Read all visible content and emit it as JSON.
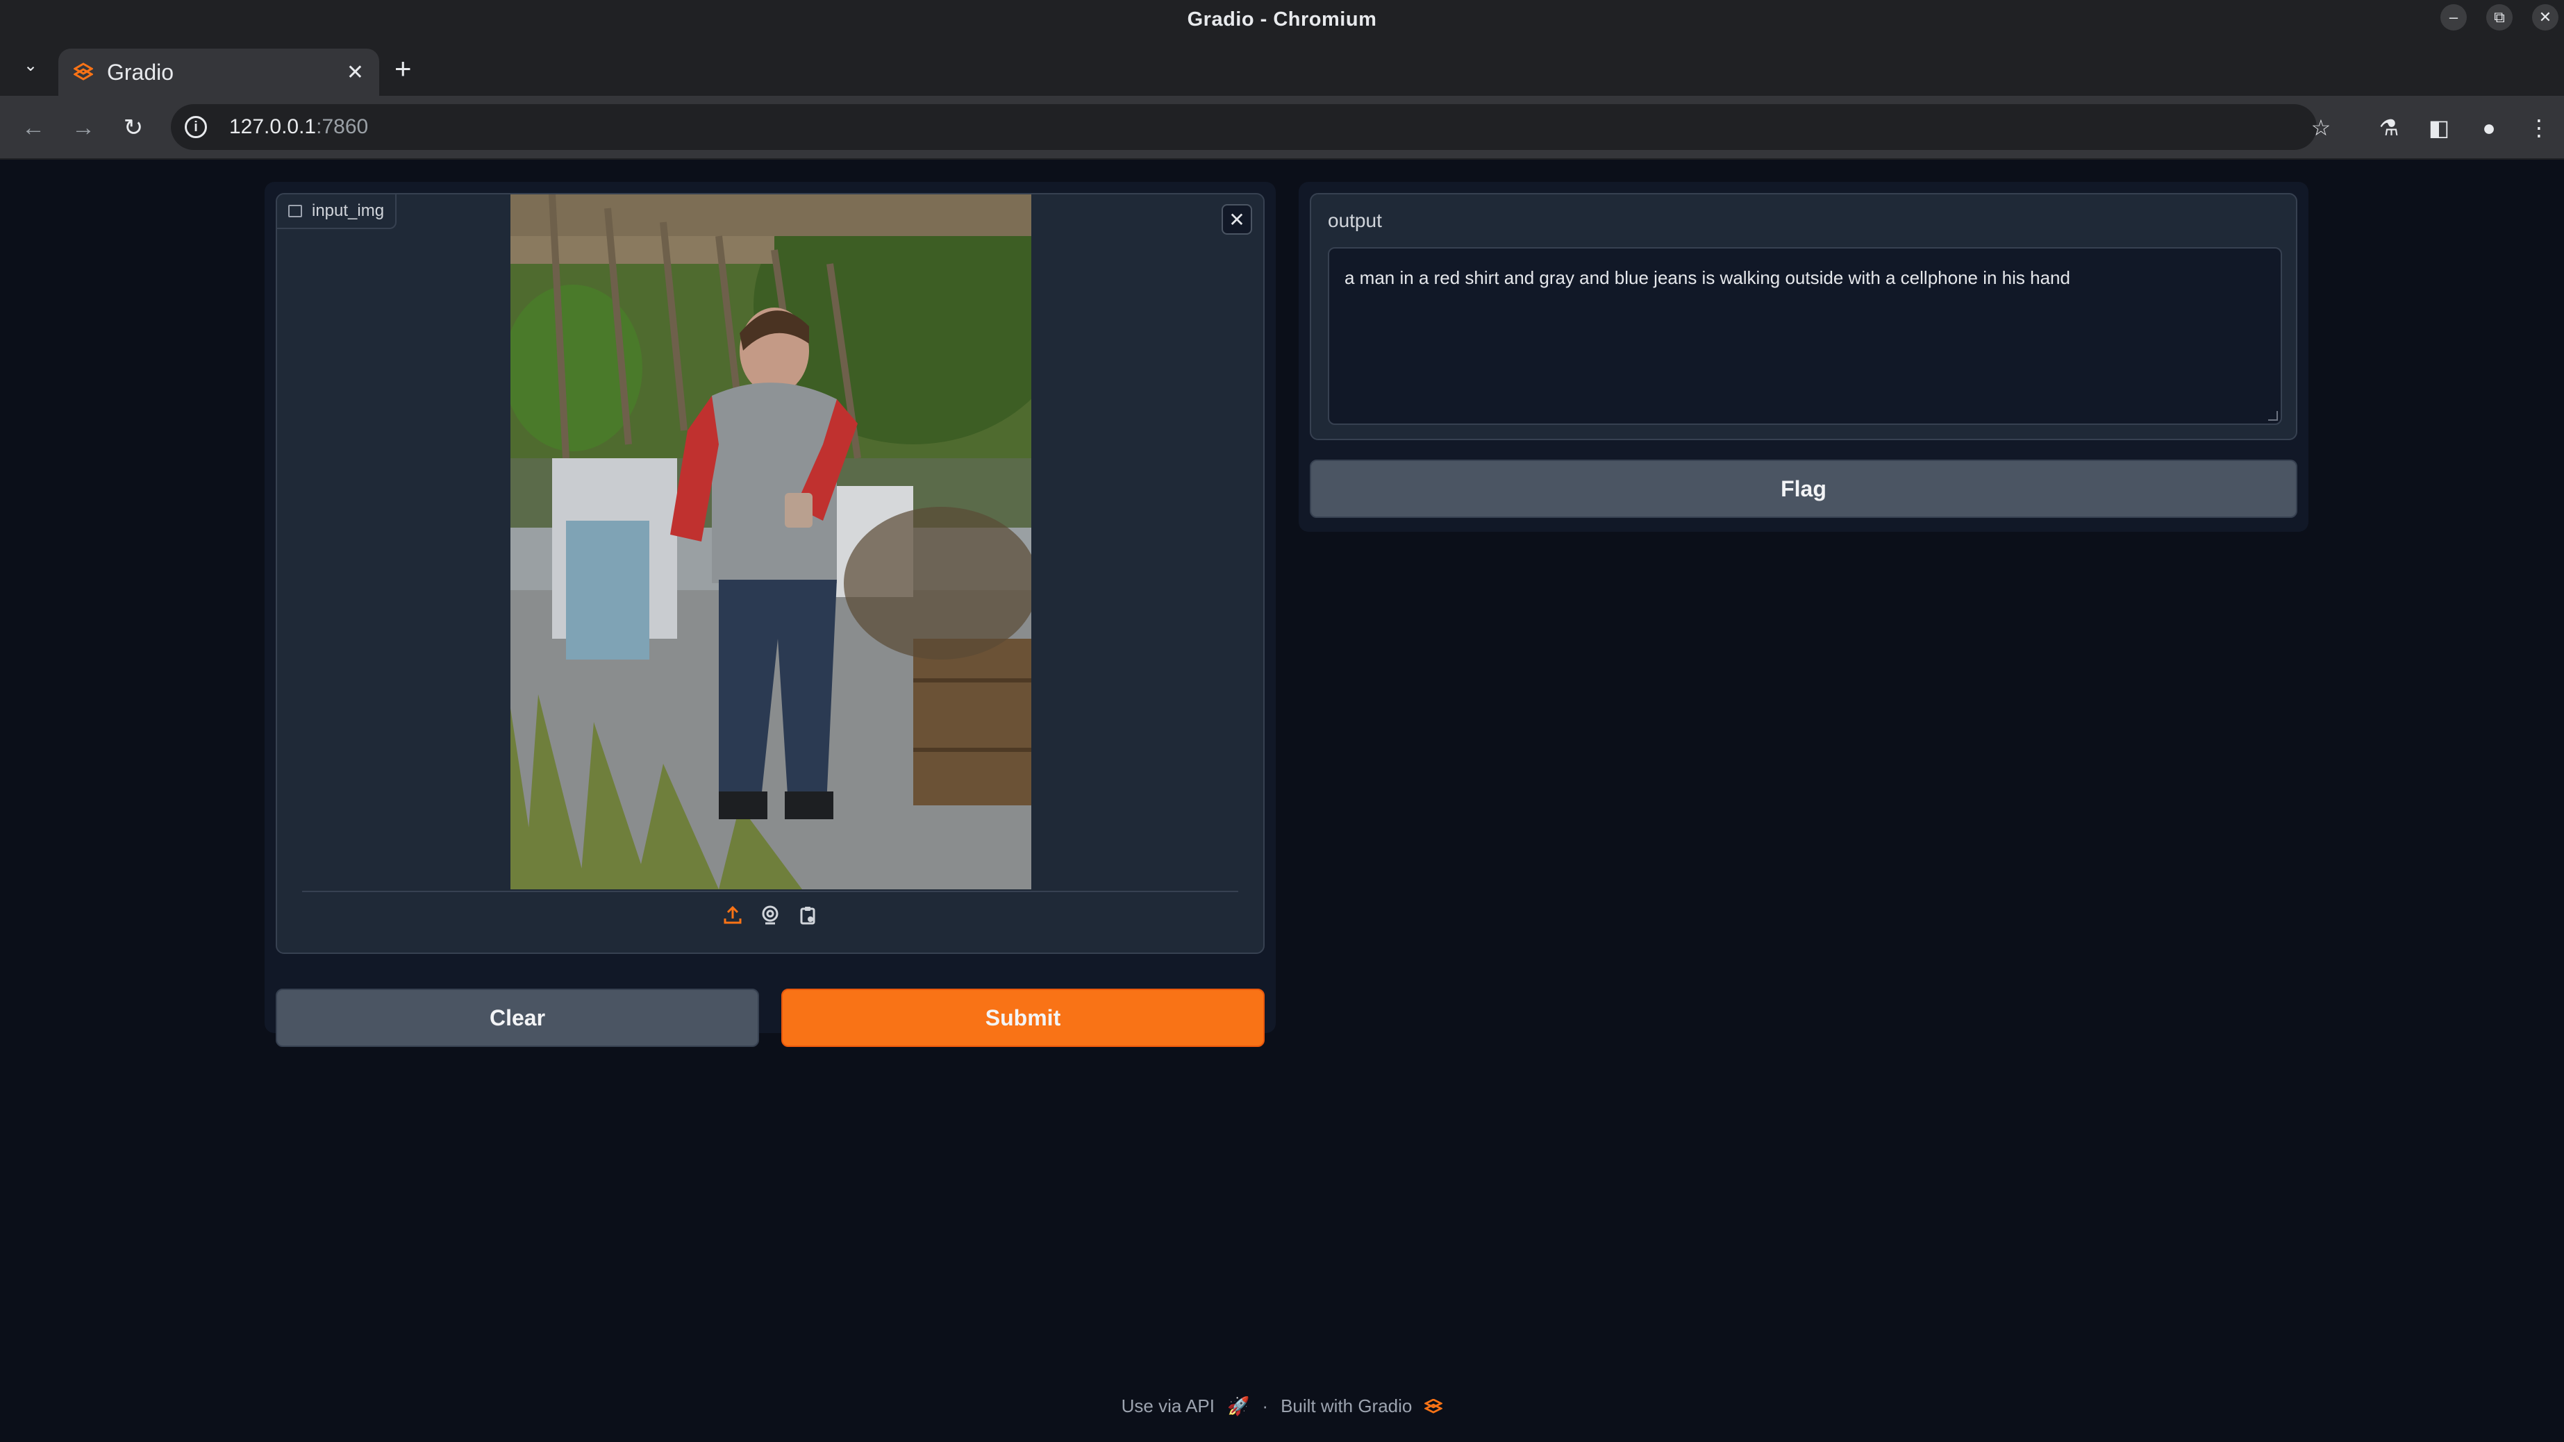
{
  "window": {
    "title": "Gradio - Chromium",
    "controls": [
      "–",
      "⧉",
      "✕"
    ]
  },
  "browser": {
    "tab_title": "Gradio",
    "new_tab": "+",
    "url_host": "127.0.0.1",
    "url_port": ":7860"
  },
  "input": {
    "label": "input_img",
    "clear_icon": "✕"
  },
  "output": {
    "label": "output",
    "text": "a man in a red shirt and gray and blue jeans is walking outside with a cellphone in his hand"
  },
  "buttons": {
    "clear": "Clear",
    "submit": "Submit",
    "flag": "Flag"
  },
  "footer": {
    "api": "Use via API",
    "separator": "·",
    "built": "Built with Gradio"
  },
  "colors": {
    "accent": "#f97316",
    "background": "#0b0f19",
    "panel": "#111827",
    "block": "#1f2937",
    "secondary_button": "#4b5563"
  }
}
